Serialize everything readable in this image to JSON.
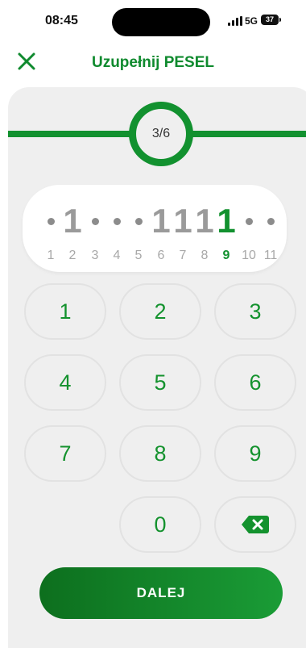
{
  "status_bar": {
    "time": "08:45",
    "network": "5G",
    "battery": "37"
  },
  "header": {
    "title": "Uzupełnij PESEL",
    "close_icon": "close-icon"
  },
  "progress": {
    "label": "3/6",
    "current": 3,
    "total": 6
  },
  "pesel": {
    "digits": [
      "",
      "1",
      "",
      "",
      "",
      "1",
      "1",
      "1",
      "1",
      "",
      ""
    ],
    "indices": [
      "1",
      "2",
      "3",
      "4",
      "5",
      "6",
      "7",
      "8",
      "9",
      "10",
      "11"
    ],
    "active_index": 8
  },
  "keypad": {
    "keys": [
      "1",
      "2",
      "3",
      "4",
      "5",
      "6",
      "7",
      "8",
      "9",
      "0"
    ],
    "backspace_icon": "backspace-icon"
  },
  "actions": {
    "next_label": "DALEJ"
  },
  "colors": {
    "accent": "#12912f",
    "panel": "#efefef"
  }
}
